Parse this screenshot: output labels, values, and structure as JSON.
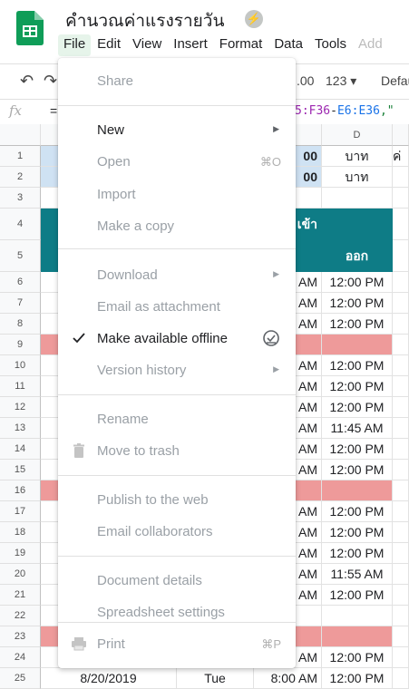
{
  "doc": {
    "title": "คำนวณค่าแรงรายวัน",
    "star_icon": "lightning-badge"
  },
  "menubar": [
    {
      "label": "File",
      "active": true
    },
    {
      "label": "Edit"
    },
    {
      "label": "View"
    },
    {
      "label": "Insert"
    },
    {
      "label": "Format"
    },
    {
      "label": "Data"
    },
    {
      "label": "Tools"
    },
    {
      "label": "Add",
      "faded": true
    }
  ],
  "toolbar": {
    "decimals": ".00",
    "number_format": "123 ▾",
    "font": "Defau"
  },
  "formula_bar": {
    "fx": "fx",
    "eq": "=",
    "formula": "5:F36-E6:E36,\""
  },
  "columns": {
    "d_header": "D"
  },
  "rows": [
    {
      "num": "1",
      "c3": "00",
      "c4": "บาท",
      "c5": "ค่"
    },
    {
      "num": "2",
      "c3": "00",
      "c4": "บาท"
    },
    {
      "num": "3"
    },
    {
      "num": "4",
      "c3": "เข้า"
    },
    {
      "num": "5",
      "c4": "ออก"
    },
    {
      "num": "6",
      "c3": "AM",
      "c4": "12:00 PM"
    },
    {
      "num": "7",
      "c3": "AM",
      "c4": "12:00 PM"
    },
    {
      "num": "8",
      "c3": "AM",
      "c4": "12:00 PM"
    },
    {
      "num": "9"
    },
    {
      "num": "10",
      "c3": "AM",
      "c4": "12:00 PM"
    },
    {
      "num": "11",
      "c3": "AM",
      "c4": "12:00 PM"
    },
    {
      "num": "12",
      "c3": "AM",
      "c4": "12:00 PM"
    },
    {
      "num": "13",
      "c3": "AM",
      "c4": "11:45 AM"
    },
    {
      "num": "14",
      "c3": "AM",
      "c4": "12:00 PM"
    },
    {
      "num": "15",
      "c3": "AM",
      "c4": "12:00 PM"
    },
    {
      "num": "16"
    },
    {
      "num": "17",
      "c3": "AM",
      "c4": "12:00 PM"
    },
    {
      "num": "18",
      "c3": "AM",
      "c4": "12:00 PM"
    },
    {
      "num": "19",
      "c3": "AM",
      "c4": "12:00 PM"
    },
    {
      "num": "20",
      "c3": "AM",
      "c4": "11:55 AM"
    },
    {
      "num": "21",
      "c3": "AM",
      "c4": "12:00 PM"
    },
    {
      "num": "22"
    },
    {
      "num": "23"
    },
    {
      "num": "24",
      "c3": "AM",
      "c4": "12:00 PM"
    },
    {
      "num": "25",
      "c1": "8/20/2019",
      "c2": "Tue",
      "c3": "8:00 AM",
      "c4": "12:00 PM"
    }
  ],
  "colors": {
    "header_teal": "#0e7c86",
    "break_row": "#ee9a9a",
    "light_blue": "#cfe2f3"
  },
  "file_menu": {
    "share": "Share",
    "new": "New",
    "open": "Open",
    "open_shortcut": "⌘O",
    "import": "Import",
    "make_copy": "Make a copy",
    "download": "Download",
    "email_attachment": "Email as attachment",
    "offline": "Make available offline",
    "version_history": "Version history",
    "rename": "Rename",
    "move_trash": "Move to trash",
    "publish": "Publish to the web",
    "email_collab": "Email collaborators",
    "doc_details": "Document details",
    "settings": "Spreadsheet settings",
    "print": "Print",
    "print_shortcut": "⌘P",
    "submenu_arrow": "▶"
  }
}
